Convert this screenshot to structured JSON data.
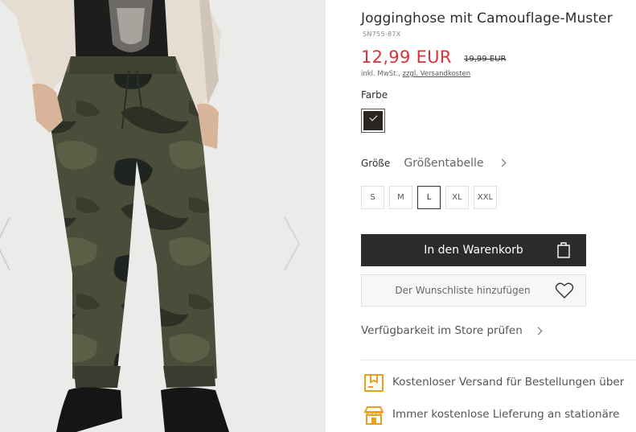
{
  "product": {
    "title": "Jogginghose mit Camouflage-Muster",
    "sku": "SN755-87X",
    "price": "12,99 EUR",
    "old_price": "19,99 EUR",
    "tax_prefix": "inkl. MwSt.,",
    "tax_link": "zzgl. Versandkosten"
  },
  "color": {
    "label": "Farbe",
    "selected_swatch_color": "#2b2522"
  },
  "size": {
    "label": "Größe",
    "size_table_link": "Größentabelle",
    "options": [
      "S",
      "M",
      "L",
      "XL",
      "XXL"
    ],
    "selected": "L"
  },
  "actions": {
    "add_to_cart": "In den Warenkorb",
    "add_to_wishlist": "Der Wunschliste hinzufügen",
    "check_store": "Verfügbarkeit im Store prüfen"
  },
  "benefits": [
    {
      "icon": "delivery-box-icon",
      "text": "Kostenloser Versand für Bestellungen über"
    },
    {
      "icon": "store-icon",
      "text": "Immer kostenlose Lieferung an stationäre"
    }
  ],
  "colors": {
    "price_red": "#d9333a",
    "button_dark": "#2b2b2b",
    "benefit_icon": "#e8a21a"
  }
}
